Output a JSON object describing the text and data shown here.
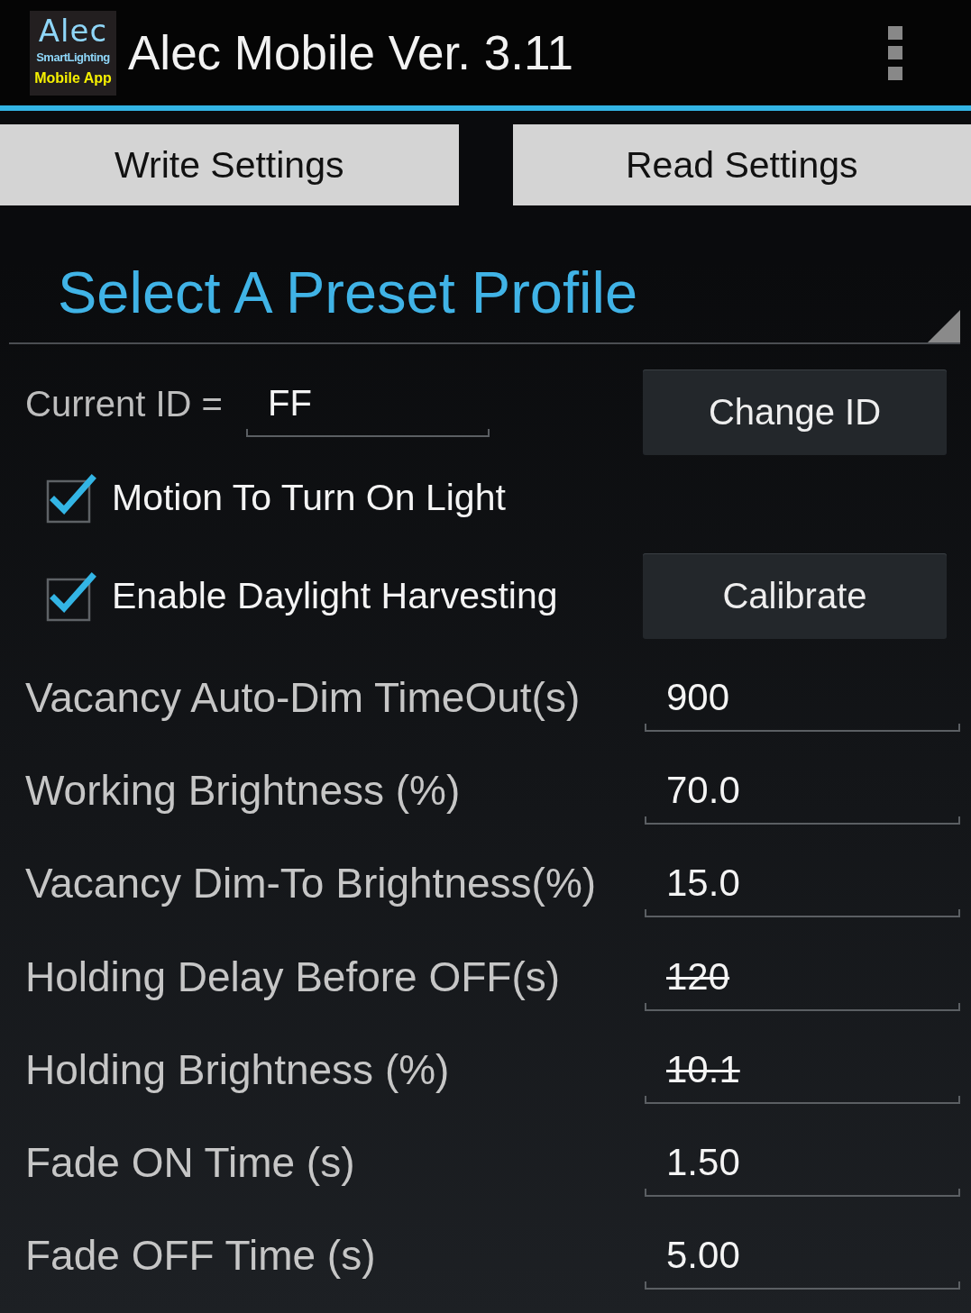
{
  "action_bar": {
    "logo": {
      "wordmark": "Alec",
      "tagline": "SmartLighting",
      "subtitle": "Mobile App"
    },
    "title": "Alec Mobile Ver. 3.11"
  },
  "top_buttons": [
    "Write Settings",
    "Read Settings"
  ],
  "preset_dropdown": {
    "label": "Select A Preset Profile"
  },
  "current_id": {
    "label": "Current ID =",
    "value": "FF",
    "button": "Change ID"
  },
  "options": [
    {
      "label": "Motion To Turn On Light",
      "checked": true
    },
    {
      "label": "Enable Daylight Harvesting",
      "checked": true,
      "button": "Calibrate"
    }
  ],
  "settings": [
    {
      "label": "Vacancy Auto-Dim TimeOut(s)",
      "value": "900",
      "struck": false
    },
    {
      "label": "Working Brightness (%)",
      "value": "70.0",
      "struck": false
    },
    {
      "label": "Vacancy Dim-To Brightness(%)",
      "value": "15.0",
      "struck": false
    },
    {
      "label": "Holding Delay Before OFF(s)",
      "value": "120",
      "struck": true
    },
    {
      "label": "Holding Brightness (%)",
      "value": "10.1",
      "struck": true
    },
    {
      "label": "Fade ON Time (s)",
      "value": "1.50",
      "struck": false
    },
    {
      "label": "Fade OFF Time (s)",
      "value": "5.00",
      "struck": false
    }
  ]
}
